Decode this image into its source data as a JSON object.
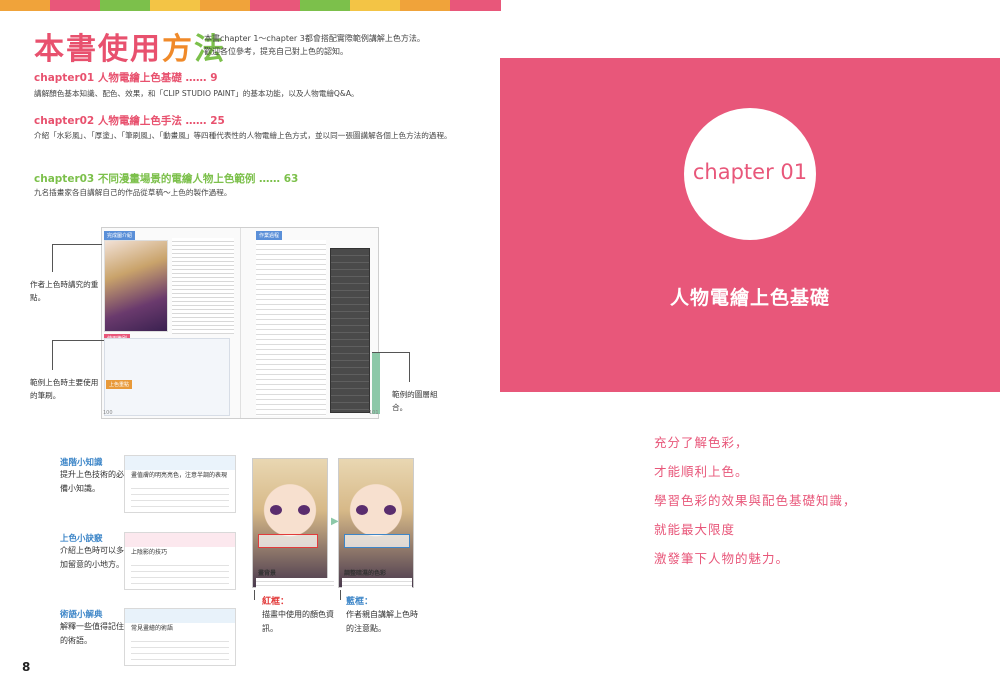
{
  "strip_colors": [
    "#f0a33a",
    "#e8577a",
    "#7cc04b",
    "#f3c445",
    "#f0a33a",
    "#e8577a",
    "#7cc04b",
    "#f3c445",
    "#f0a33a",
    "#e8577a"
  ],
  "header": {
    "title_part1": "本書使用",
    "title_part2": "方",
    "title_part3": "法",
    "intro_line1": "本書chapter 1〜chapter 3都會搭配實際範例講解上色方法。",
    "intro_line2": "歡迎各位參考，提充自己對上色的認知。"
  },
  "chapters": [
    {
      "heading": "chapter01 人物電繪上色基礎 …… 9",
      "color": "#e8516e",
      "desc": "講解顏色基本知識、配色、效果，和「CLIP STUDIO PAINT」的基本功能，以及人物電繪Q&A。"
    },
    {
      "heading": "chapter02 人物電繪上色手法 …… 25",
      "color": "#e8516e",
      "desc": "介紹「水彩風」、「厚塗」、「筆刷風」、「動畫風」等四種代表性的人物電繪上色方式，並以同一張圖講解各個上色方法的過程。"
    },
    {
      "heading": "chapter03 不同漫畫場景的電繪人物上色範例 …… 63",
      "color": "#7cc04b",
      "desc": "九名插畫家各自講解自己的作品從草稿〜上色的製作過程。"
    }
  ],
  "spread": {
    "tag1": "完成圖介紹",
    "tag2": "作業過程",
    "tag3": "使用筆刷",
    "tag4": "上色重點",
    "page_left": "100",
    "page_right": "101"
  },
  "callouts": {
    "c1": "作者上色時講究的重點。",
    "c2": "範例上色時主要使用的筆刷。",
    "c3": "範例的圖層組合。"
  },
  "sidebars": [
    {
      "heading": "進階小知識",
      "body": "提升上色技術的必備小知識。",
      "box_title": "畫值膚的明亮亮色，注意半調的表現"
    },
    {
      "heading": "上色小訣竅",
      "body": "介紹上色時可以多加留意的小地方。",
      "box_title": "上陰影的技巧"
    },
    {
      "heading": "術語小解典",
      "body": "解釋一些值得記住的術語。",
      "box_title": "常見畫繪的術語"
    }
  ],
  "compare": {
    "red_label": "紅框",
    "red_colon": "：",
    "red_desc": "描畫中使用的顏色資訊。",
    "blue_label": "藍框",
    "blue_colon": "：",
    "blue_desc": "作者親自講解上色時的注意點。",
    "caption_left": "畫背景",
    "caption_right": "調整暗濕的色彩"
  },
  "page_number": "8",
  "right_page": {
    "chapter_label": "chapter 01",
    "chapter_title": "人物電繪上色基礎",
    "poem": [
      "充分了解色彩，",
      "才能順利上色。",
      "學習色彩的效果與配色基礎知識，",
      "就能最大限度",
      "激發筆下人物的魅力。"
    ]
  }
}
